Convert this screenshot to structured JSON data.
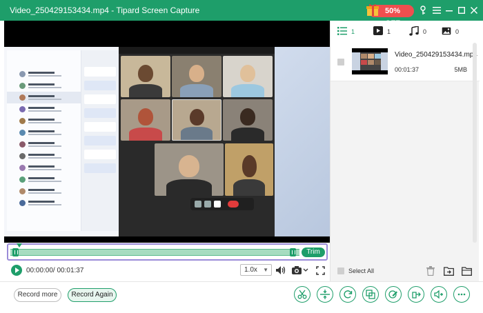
{
  "window": {
    "title": "Video_250429153434.mp4 - Tipard Screen Capture",
    "promo_label": "50% OFF",
    "accent_color": "#1e9e6a",
    "icons": [
      "gift-icon",
      "key-icon",
      "hamburger-menu-icon",
      "minimize-icon",
      "maximize-icon",
      "close-icon"
    ]
  },
  "timeline": {
    "trim_label": "Trim"
  },
  "playback": {
    "time_display": "00:00:00/ 00:01:37",
    "speed_value": "1.0x",
    "icons": [
      "play-icon",
      "volume-icon",
      "camera-icon",
      "chevron-down-icon",
      "fullscreen-icon"
    ]
  },
  "sidebar": {
    "tabs": [
      {
        "name": "list",
        "icon": "list-icon",
        "count": "1"
      },
      {
        "name": "video",
        "icon": "video-icon",
        "count": "1"
      },
      {
        "name": "audio",
        "icon": "music-note-icon",
        "count": "0"
      },
      {
        "name": "image",
        "icon": "image-icon",
        "count": "0"
      }
    ],
    "files": [
      {
        "name": "Video_250429153434.mp4",
        "duration": "00:01:37",
        "size": "5MB"
      }
    ],
    "select_all_label": "Select All",
    "footer_icons": [
      "trash-icon",
      "folder-export-icon",
      "folder-icon"
    ]
  },
  "bottom": {
    "record_more_label": "Record more",
    "record_again_label": "Record Again",
    "tool_icons": [
      "scissors-icon",
      "split-icon",
      "rotate-icon",
      "merge-icon",
      "edit-icon",
      "convert-icon",
      "volume-boost-icon",
      "more-icon"
    ]
  }
}
